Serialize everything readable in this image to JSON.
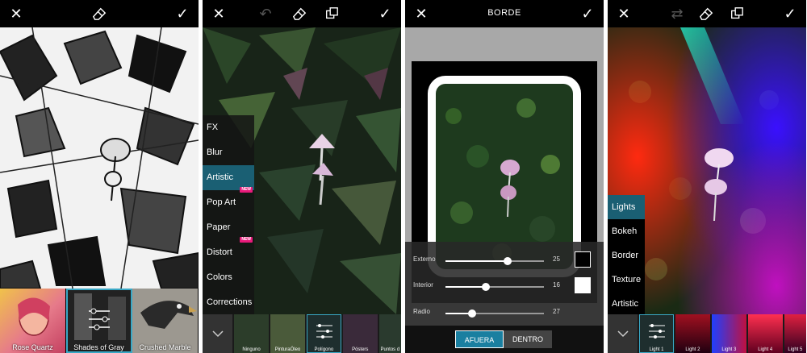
{
  "panel1": {
    "filters": [
      {
        "label": "Rose Quartz"
      },
      {
        "label": "Shades of Gray"
      },
      {
        "label": "Crushed Marble"
      }
    ]
  },
  "panel2": {
    "menu": [
      {
        "label": "FX",
        "badge": ""
      },
      {
        "label": "Blur",
        "badge": ""
      },
      {
        "label": "Artistic",
        "badge": ""
      },
      {
        "label": "Pop Art",
        "badge": "NEW"
      },
      {
        "label": "Paper",
        "badge": ""
      },
      {
        "label": "Distort",
        "badge": "NEW"
      },
      {
        "label": "Colors",
        "badge": ""
      },
      {
        "label": "Corrections",
        "badge": ""
      }
    ],
    "effects": [
      "Ninguno",
      "PinturaÓleo",
      "Polígono",
      "Pósters",
      "Puntos d"
    ]
  },
  "panel3": {
    "title": "BORDE",
    "sliders": [
      {
        "label": "Externo",
        "value": "25",
        "fraction": 0.63
      },
      {
        "label": "Interior",
        "value": "16",
        "fraction": 0.41
      },
      {
        "label": "Radio",
        "value": "27",
        "fraction": 0.27
      }
    ],
    "segments": [
      {
        "label": "AFUERA"
      },
      {
        "label": "DENTRO"
      }
    ],
    "accent": "#1a7fa0"
  },
  "panel4": {
    "menu": [
      {
        "label": "Lights"
      },
      {
        "label": "Bokeh"
      },
      {
        "label": "Border"
      },
      {
        "label": "Texture"
      },
      {
        "label": "Artistic"
      }
    ],
    "effects": [
      "Light 1",
      "Light 2",
      "Light 3",
      "Light 4",
      "Light 5"
    ]
  }
}
